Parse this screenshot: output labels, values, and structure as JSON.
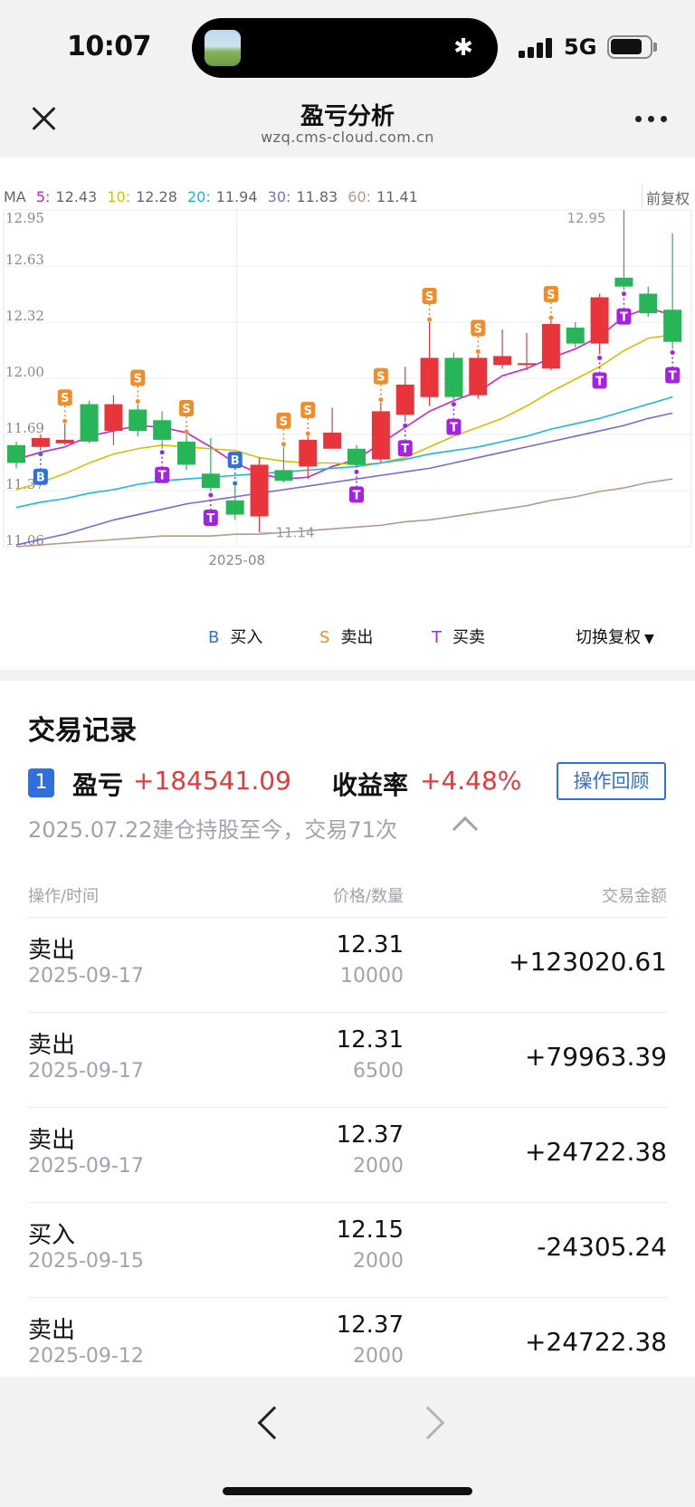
{
  "status": {
    "time": "10:07",
    "network": "5G"
  },
  "nav": {
    "title": "盈亏分析",
    "url": "wzq.cms-cloud.com.cn"
  },
  "ma": {
    "label": "MA",
    "items": [
      {
        "k": "5:",
        "v": "12.43",
        "color": "#d41ec8"
      },
      {
        "k": "10:",
        "v": "12.28",
        "color": "#d6c000"
      },
      {
        "k": "20:",
        "v": "11.94",
        "color": "#19b7e8"
      },
      {
        "k": "30:",
        "v": "11.83",
        "color": "#7b68d8"
      },
      {
        "k": "60:",
        "v": "11.41",
        "color": "#b59a8a"
      }
    ],
    "adjust": "前复权"
  },
  "chart_data": {
    "type": "candlestick",
    "y_ticks": [
      "12.95",
      "12.63",
      "12.32",
      "12.00",
      "11.69",
      "11.37",
      "11.06"
    ],
    "ylim": [
      11.06,
      12.95
    ],
    "x_label": "2025-08",
    "high_label": "12.95",
    "low_label": "11.14",
    "candles": [
      {
        "o": 11.63,
        "c": 11.53,
        "h": 11.65,
        "l": 11.5
      },
      {
        "o": 11.62,
        "c": 11.67,
        "h": 11.69,
        "l": 11.6
      },
      {
        "o": 11.64,
        "c": 11.66,
        "h": 11.75,
        "l": 11.63
      },
      {
        "o": 11.86,
        "c": 11.65,
        "h": 11.88,
        "l": 11.64
      },
      {
        "o": 11.71,
        "c": 11.86,
        "h": 11.91,
        "l": 11.63
      },
      {
        "o": 11.83,
        "c": 11.71,
        "h": 11.86,
        "l": 11.68
      },
      {
        "o": 11.77,
        "c": 11.66,
        "h": 11.82,
        "l": 11.61
      },
      {
        "o": 11.65,
        "c": 11.52,
        "h": 11.69,
        "l": 11.49
      },
      {
        "o": 11.47,
        "c": 11.39,
        "h": 11.67,
        "l": 11.37
      },
      {
        "o": 11.32,
        "c": 11.24,
        "h": 11.4,
        "l": 11.21
      },
      {
        "o": 11.23,
        "c": 11.52,
        "h": 11.56,
        "l": 11.14
      },
      {
        "o": 11.49,
        "c": 11.43,
        "h": 11.62,
        "l": 11.42
      },
      {
        "o": 11.51,
        "c": 11.66,
        "h": 11.68,
        "l": 11.44
      },
      {
        "o": 11.61,
        "c": 11.7,
        "h": 11.84,
        "l": 11.61
      },
      {
        "o": 11.61,
        "c": 11.52,
        "h": 11.63,
        "l": 11.5
      },
      {
        "o": 11.55,
        "c": 11.82,
        "h": 11.87,
        "l": 11.53
      },
      {
        "o": 11.8,
        "c": 11.97,
        "h": 12.07,
        "l": 11.76
      },
      {
        "o": 11.9,
        "c": 12.12,
        "h": 12.32,
        "l": 11.85
      },
      {
        "o": 12.12,
        "c": 11.9,
        "h": 12.15,
        "l": 11.88
      },
      {
        "o": 11.91,
        "c": 12.12,
        "h": 12.14,
        "l": 11.89
      },
      {
        "o": 12.08,
        "c": 12.13,
        "h": 12.28,
        "l": 12.06
      },
      {
        "o": 12.08,
        "c": 12.09,
        "h": 12.26,
        "l": 12.05
      },
      {
        "o": 12.06,
        "c": 12.31,
        "h": 12.33,
        "l": 12.05
      },
      {
        "o": 12.29,
        "c": 12.2,
        "h": 12.32,
        "l": 12.18
      },
      {
        "o": 12.2,
        "c": 12.46,
        "h": 12.48,
        "l": 12.14
      },
      {
        "o": 12.57,
        "c": 12.52,
        "h": 12.95,
        "l": 12.5
      },
      {
        "o": 12.48,
        "c": 12.37,
        "h": 12.52,
        "l": 12.35
      },
      {
        "o": 12.39,
        "c": 12.21,
        "h": 12.82,
        "l": 12.17
      }
    ],
    "ma_series": [
      {
        "name": "MA5",
        "color": "#d41ec8",
        "values": [
          11.55,
          11.59,
          11.62,
          11.68,
          11.71,
          11.74,
          11.73,
          11.7,
          11.62,
          11.53,
          11.47,
          11.44,
          11.45,
          11.51,
          11.55,
          11.64,
          11.73,
          11.82,
          11.88,
          11.93,
          12.02,
          12.06,
          12.12,
          12.17,
          12.24,
          12.35,
          12.4,
          12.36
        ]
      },
      {
        "name": "MA10",
        "color": "#d6c000",
        "values": [
          11.38,
          11.42,
          11.47,
          11.53,
          11.58,
          11.61,
          11.63,
          11.62,
          11.61,
          11.6,
          11.56,
          11.54,
          11.53,
          11.53,
          11.52,
          11.53,
          11.56,
          11.62,
          11.68,
          11.73,
          11.78,
          11.85,
          11.93,
          12.0,
          12.07,
          12.16,
          12.23,
          12.25
        ]
      },
      {
        "name": "MA20",
        "color": "#19b7e8",
        "values": [
          11.28,
          11.31,
          11.33,
          11.36,
          11.38,
          11.41,
          11.43,
          11.44,
          11.45,
          11.46,
          11.47,
          11.48,
          11.49,
          11.5,
          11.51,
          11.53,
          11.55,
          11.58,
          11.6,
          11.62,
          11.65,
          11.68,
          11.72,
          11.75,
          11.78,
          11.82,
          11.86,
          11.9
        ]
      },
      {
        "name": "MA30",
        "color": "#7b68d8",
        "values": [
          11.07,
          11.1,
          11.13,
          11.17,
          11.21,
          11.24,
          11.27,
          11.3,
          11.32,
          11.34,
          11.36,
          11.38,
          11.4,
          11.42,
          11.44,
          11.46,
          11.48,
          11.5,
          11.53,
          11.56,
          11.59,
          11.62,
          11.65,
          11.68,
          11.71,
          11.74,
          11.78,
          11.81
        ]
      },
      {
        "name": "MA60",
        "color": "#b59a8a",
        "values": [
          11.06,
          11.07,
          11.08,
          11.09,
          11.1,
          11.11,
          11.12,
          11.12,
          11.12,
          11.13,
          11.13,
          11.14,
          11.15,
          11.16,
          11.17,
          11.18,
          11.2,
          11.21,
          11.23,
          11.25,
          11.27,
          11.29,
          11.32,
          11.34,
          11.37,
          11.39,
          11.42,
          11.44
        ]
      }
    ],
    "markers": [
      {
        "i": 1,
        "type": "B",
        "pos": "below"
      },
      {
        "i": 2,
        "type": "S",
        "pos": "above"
      },
      {
        "i": 5,
        "type": "S",
        "pos": "above"
      },
      {
        "i": 6,
        "type": "T",
        "pos": "below"
      },
      {
        "i": 7,
        "type": "S",
        "pos": "above"
      },
      {
        "i": 8,
        "type": "T",
        "pos": "below"
      },
      {
        "i": 9,
        "type": "B",
        "pos": "above"
      },
      {
        "i": 11,
        "type": "S",
        "pos": "above"
      },
      {
        "i": 12,
        "type": "S",
        "pos": "above"
      },
      {
        "i": 14,
        "type": "T",
        "pos": "below"
      },
      {
        "i": 15,
        "type": "S",
        "pos": "above"
      },
      {
        "i": 16,
        "type": "T",
        "pos": "below"
      },
      {
        "i": 17,
        "type": "S",
        "pos": "above"
      },
      {
        "i": 18,
        "type": "T",
        "pos": "below"
      },
      {
        "i": 19,
        "type": "S",
        "pos": "above"
      },
      {
        "i": 22,
        "type": "S",
        "pos": "above"
      },
      {
        "i": 24,
        "type": "T",
        "pos": "below"
      },
      {
        "i": 25,
        "type": "T",
        "pos": "below"
      },
      {
        "i": 27,
        "type": "T",
        "pos": "below"
      }
    ]
  },
  "legend": {
    "b_mark": "B",
    "b_text": "买入",
    "s_mark": "S",
    "s_text": "卖出",
    "t_mark": "T",
    "t_text": "买卖",
    "switch": "切换复权"
  },
  "colors": {
    "up": "#e8353b",
    "down": "#27b558",
    "buy": "#2f6fe0",
    "sell": "#f28c28",
    "trade": "#a323e0"
  },
  "records": {
    "title": "交易记录",
    "account": "1",
    "pl_label": "盈亏",
    "pl_value": "+184541.09",
    "rate_label": "收益率",
    "rate_value": "+4.48%",
    "review": "操作回顾",
    "hold_info": "2025.07.22建仓持股至今，交易71次",
    "headers": {
      "op": "操作/时间",
      "price": "价格/数量",
      "amount": "交易金额"
    },
    "rows": [
      {
        "action": "卖出",
        "date": "2025-09-17",
        "price": "12.31",
        "qty": "10000",
        "amount": "+123020.61"
      },
      {
        "action": "卖出",
        "date": "2025-09-17",
        "price": "12.31",
        "qty": "6500",
        "amount": "+79963.39"
      },
      {
        "action": "卖出",
        "date": "2025-09-17",
        "price": "12.37",
        "qty": "2000",
        "amount": "+24722.38"
      },
      {
        "action": "买入",
        "date": "2025-09-15",
        "price": "12.15",
        "qty": "2000",
        "amount": "-24305.24"
      },
      {
        "action": "卖出",
        "date": "2025-09-12",
        "price": "12.37",
        "qty": "2000",
        "amount": "+24722.38"
      }
    ]
  }
}
